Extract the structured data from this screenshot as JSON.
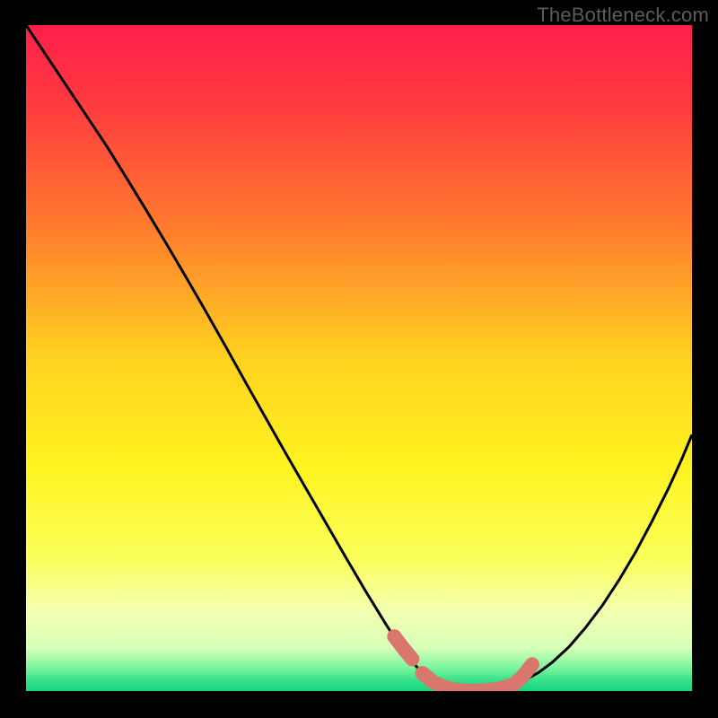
{
  "watermark": "TheBottleneck.com",
  "chart_data": {
    "type": "line",
    "title": "",
    "xlabel": "",
    "ylabel": "",
    "xlim": [
      0,
      1
    ],
    "ylim": [
      0,
      1
    ],
    "gradient_stops": [
      {
        "offset": 0.0,
        "color": "#ff1f4a"
      },
      {
        "offset": 0.12,
        "color": "#ff3b3f"
      },
      {
        "offset": 0.3,
        "color": "#ff7a2e"
      },
      {
        "offset": 0.5,
        "color": "#ffd21f"
      },
      {
        "offset": 0.66,
        "color": "#fff31f"
      },
      {
        "offset": 0.8,
        "color": "#fbff5a"
      },
      {
        "offset": 0.88,
        "color": "#f3ffb0"
      },
      {
        "offset": 0.935,
        "color": "#d8ffb8"
      },
      {
        "offset": 0.965,
        "color": "#7cf59d"
      },
      {
        "offset": 0.985,
        "color": "#34e08a"
      },
      {
        "offset": 1.0,
        "color": "#17d47e"
      }
    ],
    "series": [
      {
        "name": "bottleneck-curve",
        "stroke": "#000000",
        "stroke_width": 3,
        "points": [
          [
            0.0,
            1.0
          ],
          [
            0.03,
            0.955
          ],
          [
            0.06,
            0.91
          ],
          [
            0.09,
            0.865
          ],
          [
            0.12,
            0.82
          ],
          [
            0.15,
            0.772
          ],
          [
            0.18,
            0.723
          ],
          [
            0.21,
            0.673
          ],
          [
            0.24,
            0.622
          ],
          [
            0.27,
            0.57
          ],
          [
            0.3,
            0.517
          ],
          [
            0.33,
            0.463
          ],
          [
            0.36,
            0.41
          ],
          [
            0.39,
            0.357
          ],
          [
            0.42,
            0.305
          ],
          [
            0.45,
            0.253
          ],
          [
            0.48,
            0.201
          ],
          [
            0.51,
            0.15
          ],
          [
            0.54,
            0.101
          ],
          [
            0.56,
            0.07
          ],
          [
            0.58,
            0.044
          ],
          [
            0.595,
            0.027
          ],
          [
            0.61,
            0.014
          ],
          [
            0.627,
            0.006
          ],
          [
            0.645,
            0.002
          ],
          [
            0.665,
            0.0
          ],
          [
            0.685,
            0.0
          ],
          [
            0.705,
            0.002
          ],
          [
            0.718,
            0.005
          ],
          [
            0.733,
            0.009
          ],
          [
            0.75,
            0.017
          ],
          [
            0.77,
            0.028
          ],
          [
            0.79,
            0.043
          ],
          [
            0.815,
            0.066
          ],
          [
            0.84,
            0.095
          ],
          [
            0.865,
            0.128
          ],
          [
            0.89,
            0.166
          ],
          [
            0.915,
            0.208
          ],
          [
            0.94,
            0.255
          ],
          [
            0.965,
            0.305
          ],
          [
            0.985,
            0.349
          ],
          [
            1.0,
            0.385
          ]
        ]
      },
      {
        "name": "highlight-band",
        "stroke": "#d9776c",
        "stroke_width": 16,
        "linecap": "round",
        "points": [
          [
            0.553,
            0.082
          ],
          [
            0.566,
            0.065
          ],
          [
            0.58,
            0.048
          ]
        ]
      },
      {
        "name": "highlight-band-b",
        "stroke": "#d9776c",
        "stroke_width": 16,
        "linecap": "round",
        "points": [
          [
            0.595,
            0.027
          ],
          [
            0.612,
            0.013
          ],
          [
            0.63,
            0.005
          ],
          [
            0.65,
            0.001
          ],
          [
            0.67,
            0.0
          ],
          [
            0.69,
            0.001
          ],
          [
            0.708,
            0.003
          ],
          [
            0.72,
            0.006
          ],
          [
            0.732,
            0.01
          ],
          [
            0.745,
            0.021
          ],
          [
            0.76,
            0.04
          ]
        ]
      }
    ]
  }
}
